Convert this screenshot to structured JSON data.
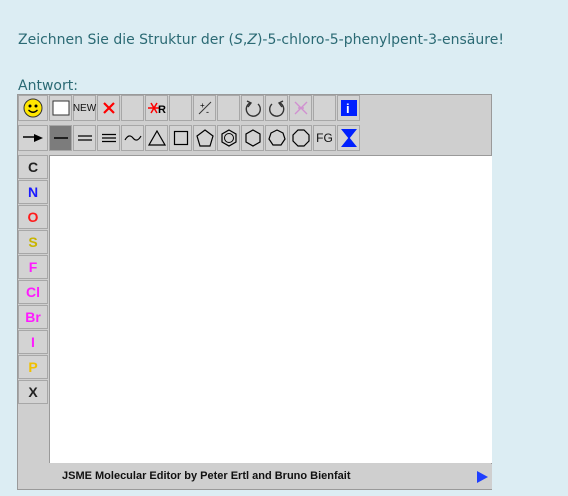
{
  "question": {
    "prefix": "Zeichnen Sie die Struktur der (",
    "stereo_S": "S",
    "stereo_comma": ",",
    "stereo_Z": "Z",
    "suffix": ")-5-chloro-5-phenylpent-3-ensäure!"
  },
  "answer_label": "Antwort:",
  "toolbar_row1": [
    {
      "name": "smile-icon",
      "label": ""
    },
    {
      "name": "clear-icon",
      "label": ""
    },
    {
      "name": "new-button",
      "label": "NEW"
    },
    {
      "name": "delete-icon",
      "label": ""
    },
    {
      "name": "empty",
      "label": ""
    },
    {
      "name": "delete-r-icon",
      "label": "R"
    },
    {
      "name": "empty",
      "label": ""
    },
    {
      "name": "charge-icon",
      "label": ""
    },
    {
      "name": "empty",
      "label": ""
    },
    {
      "name": "undo-icon",
      "label": ""
    },
    {
      "name": "redo-icon",
      "label": ""
    },
    {
      "name": "multi-reaction-icon",
      "label": ""
    },
    {
      "name": "empty",
      "label": ""
    },
    {
      "name": "info-icon",
      "label": "i"
    }
  ],
  "toolbar_row2": {
    "fg_label": "FG"
  },
  "atoms": [
    {
      "label": "C",
      "color": "#222222"
    },
    {
      "label": "N",
      "color": "#1b1bff"
    },
    {
      "label": "O",
      "color": "#ff1b1b"
    },
    {
      "label": "S",
      "color": "#c8b400"
    },
    {
      "label": "F",
      "color": "#ff1bff"
    },
    {
      "label": "Cl",
      "color": "#ff1bff"
    },
    {
      "label": "Br",
      "color": "#ff1bff"
    },
    {
      "label": "I",
      "color": "#ff1bff"
    },
    {
      "label": "P",
      "color": "#f0c000"
    },
    {
      "label": "X",
      "color": "#222222"
    }
  ],
  "status": "JSME Molecular Editor by Peter Ertl and Bruno Bienfait"
}
